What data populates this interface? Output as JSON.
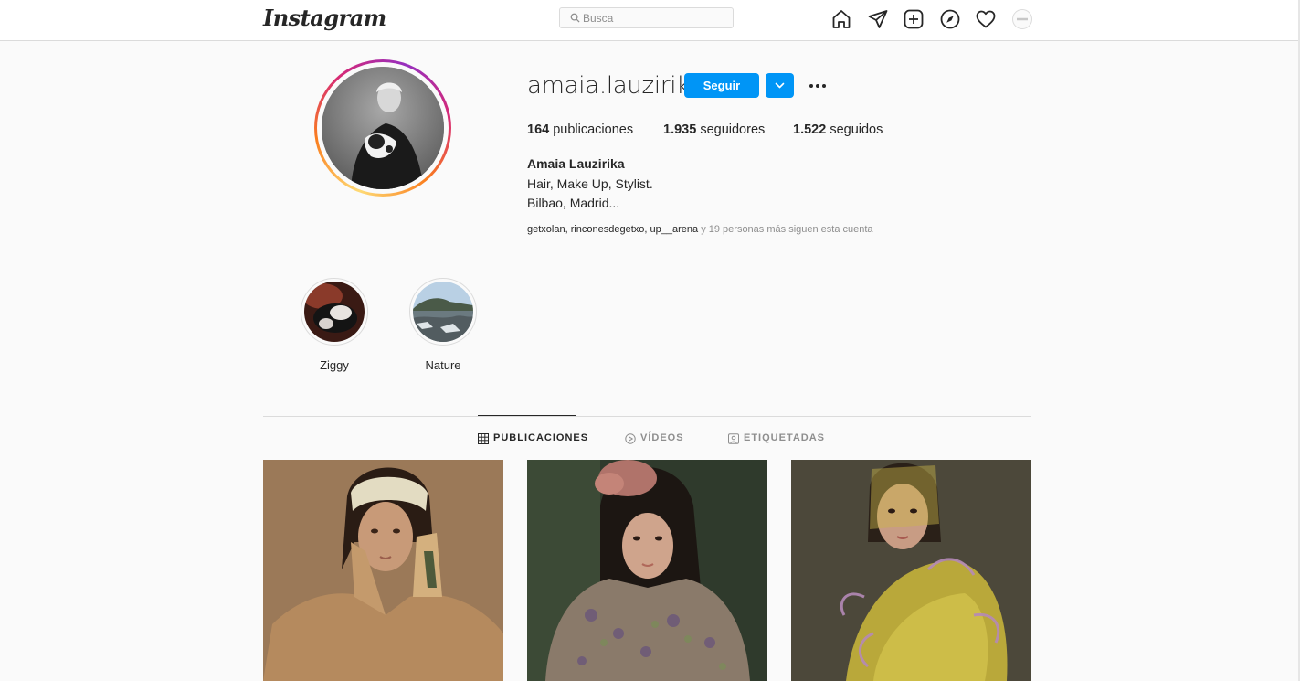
{
  "nav": {
    "logo": "Instagram",
    "search_placeholder": "Busca"
  },
  "profile": {
    "username": "amaia.lauzirika",
    "follow_label": "Seguir",
    "stats": [
      {
        "count": "164",
        "label": "publicaciones"
      },
      {
        "count": "1.935",
        "label": "seguidores"
      },
      {
        "count": "1.522",
        "label": "seguidos"
      }
    ],
    "full_name": "Amaia Lauzirika",
    "bio_lines": [
      "Hair, Make Up, Stylist.",
      "Bilbao, Madrid..."
    ],
    "followed_by": {
      "users": "getxolan, rinconesdegetxo, up__arena",
      "rest": " y 19 personas más siguen esta cuenta"
    }
  },
  "highlights": [
    {
      "label": "Ziggy"
    },
    {
      "label": "Nature"
    }
  ],
  "tabs": [
    {
      "label": "PUBLICACIONES",
      "active": true
    },
    {
      "label": "VÍDEOS",
      "active": false
    },
    {
      "label": "ETIQUETADAS",
      "active": false
    }
  ],
  "colors": {
    "accent": "#0095f6",
    "text": "#262626",
    "muted": "#8e8e8e",
    "border": "#dbdbdb",
    "background": "#fafafa"
  },
  "icons": [
    "home-icon",
    "direct-icon",
    "new-post-icon",
    "explore-icon",
    "activity-heart-icon",
    "profile-avatar-icon",
    "search-icon",
    "chevron-down-icon",
    "more-options-icon",
    "grid-icon",
    "video-icon",
    "tagged-icon"
  ]
}
